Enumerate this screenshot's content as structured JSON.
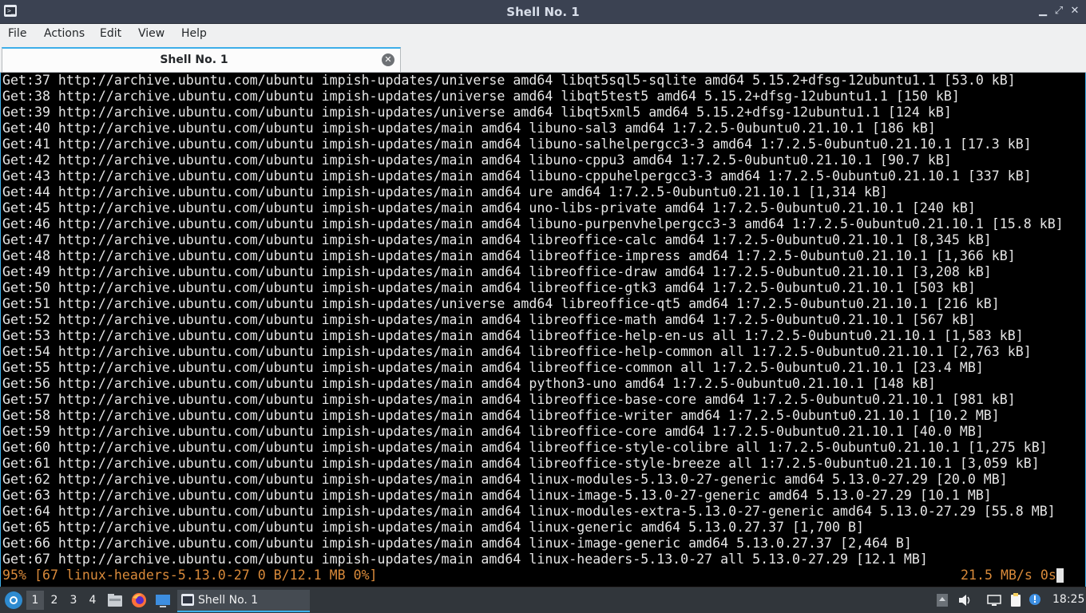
{
  "window": {
    "title": "Shell No. 1",
    "terminal_icon_glyph": ">_"
  },
  "menu": [
    "File",
    "Actions",
    "Edit",
    "View",
    "Help"
  ],
  "tab": {
    "label": "Shell No. 1"
  },
  "terminal_lines": [
    "Get:37 http://archive.ubuntu.com/ubuntu impish-updates/universe amd64 libqt5sql5-sqlite amd64 5.15.2+dfsg-12ubuntu1.1 [53.0 kB]",
    "Get:38 http://archive.ubuntu.com/ubuntu impish-updates/universe amd64 libqt5test5 amd64 5.15.2+dfsg-12ubuntu1.1 [150 kB]",
    "Get:39 http://archive.ubuntu.com/ubuntu impish-updates/universe amd64 libqt5xml5 amd64 5.15.2+dfsg-12ubuntu1.1 [124 kB]",
    "Get:40 http://archive.ubuntu.com/ubuntu impish-updates/main amd64 libuno-sal3 amd64 1:7.2.5-0ubuntu0.21.10.1 [186 kB]",
    "Get:41 http://archive.ubuntu.com/ubuntu impish-updates/main amd64 libuno-salhelpergcc3-3 amd64 1:7.2.5-0ubuntu0.21.10.1 [17.3 kB]",
    "Get:42 http://archive.ubuntu.com/ubuntu impish-updates/main amd64 libuno-cppu3 amd64 1:7.2.5-0ubuntu0.21.10.1 [90.7 kB]",
    "Get:43 http://archive.ubuntu.com/ubuntu impish-updates/main amd64 libuno-cppuhelpergcc3-3 amd64 1:7.2.5-0ubuntu0.21.10.1 [337 kB]",
    "Get:44 http://archive.ubuntu.com/ubuntu impish-updates/main amd64 ure amd64 1:7.2.5-0ubuntu0.21.10.1 [1,314 kB]",
    "Get:45 http://archive.ubuntu.com/ubuntu impish-updates/main amd64 uno-libs-private amd64 1:7.2.5-0ubuntu0.21.10.1 [240 kB]",
    "Get:46 http://archive.ubuntu.com/ubuntu impish-updates/main amd64 libuno-purpenvhelpergcc3-3 amd64 1:7.2.5-0ubuntu0.21.10.1 [15.8 kB]",
    "Get:47 http://archive.ubuntu.com/ubuntu impish-updates/main amd64 libreoffice-calc amd64 1:7.2.5-0ubuntu0.21.10.1 [8,345 kB]",
    "Get:48 http://archive.ubuntu.com/ubuntu impish-updates/main amd64 libreoffice-impress amd64 1:7.2.5-0ubuntu0.21.10.1 [1,366 kB]",
    "Get:49 http://archive.ubuntu.com/ubuntu impish-updates/main amd64 libreoffice-draw amd64 1:7.2.5-0ubuntu0.21.10.1 [3,208 kB]",
    "Get:50 http://archive.ubuntu.com/ubuntu impish-updates/main amd64 libreoffice-gtk3 amd64 1:7.2.5-0ubuntu0.21.10.1 [503 kB]",
    "Get:51 http://archive.ubuntu.com/ubuntu impish-updates/universe amd64 libreoffice-qt5 amd64 1:7.2.5-0ubuntu0.21.10.1 [216 kB]",
    "Get:52 http://archive.ubuntu.com/ubuntu impish-updates/main amd64 libreoffice-math amd64 1:7.2.5-0ubuntu0.21.10.1 [567 kB]",
    "Get:53 http://archive.ubuntu.com/ubuntu impish-updates/main amd64 libreoffice-help-en-us all 1:7.2.5-0ubuntu0.21.10.1 [1,583 kB]",
    "Get:54 http://archive.ubuntu.com/ubuntu impish-updates/main amd64 libreoffice-help-common all 1:7.2.5-0ubuntu0.21.10.1 [2,763 kB]",
    "Get:55 http://archive.ubuntu.com/ubuntu impish-updates/main amd64 libreoffice-common all 1:7.2.5-0ubuntu0.21.10.1 [23.4 MB]",
    "Get:56 http://archive.ubuntu.com/ubuntu impish-updates/main amd64 python3-uno amd64 1:7.2.5-0ubuntu0.21.10.1 [148 kB]",
    "Get:57 http://archive.ubuntu.com/ubuntu impish-updates/main amd64 libreoffice-base-core amd64 1:7.2.5-0ubuntu0.21.10.1 [981 kB]",
    "Get:58 http://archive.ubuntu.com/ubuntu impish-updates/main amd64 libreoffice-writer amd64 1:7.2.5-0ubuntu0.21.10.1 [10.2 MB]",
    "Get:59 http://archive.ubuntu.com/ubuntu impish-updates/main amd64 libreoffice-core amd64 1:7.2.5-0ubuntu0.21.10.1 [40.0 MB]",
    "Get:60 http://archive.ubuntu.com/ubuntu impish-updates/main amd64 libreoffice-style-colibre all 1:7.2.5-0ubuntu0.21.10.1 [1,275 kB]",
    "Get:61 http://archive.ubuntu.com/ubuntu impish-updates/main amd64 libreoffice-style-breeze all 1:7.2.5-0ubuntu0.21.10.1 [3,059 kB]",
    "Get:62 http://archive.ubuntu.com/ubuntu impish-updates/main amd64 linux-modules-5.13.0-27-generic amd64 5.13.0-27.29 [20.0 MB]",
    "Get:63 http://archive.ubuntu.com/ubuntu impish-updates/main amd64 linux-image-5.13.0-27-generic amd64 5.13.0-27.29 [10.1 MB]",
    "Get:64 http://archive.ubuntu.com/ubuntu impish-updates/main amd64 linux-modules-extra-5.13.0-27-generic amd64 5.13.0-27.29 [55.8 MB]",
    "Get:65 http://archive.ubuntu.com/ubuntu impish-updates/main amd64 linux-generic amd64 5.13.0.27.37 [1,700 B]",
    "Get:66 http://archive.ubuntu.com/ubuntu impish-updates/main amd64 linux-image-generic amd64 5.13.0.27.37 [2,464 B]",
    "Get:67 http://archive.ubuntu.com/ubuntu impish-updates/main amd64 linux-headers-5.13.0-27 all 5.13.0-27.29 [12.1 MB]"
  ],
  "progress_line": "95% [67 linux-headers-5.13.0-27 0 B/12.1 MB 0%]",
  "rate_line": "21.5 MB/s 0s",
  "colors": {
    "progress_text": "#d98a3a",
    "accent": "#3daee9",
    "terminal_bg": "#000000"
  },
  "taskbar": {
    "workspaces": [
      "1",
      "2",
      "3",
      "4"
    ],
    "active_workspace": "1",
    "launchers": [
      "file-manager-icon",
      "firefox-icon",
      "desktop-icon"
    ],
    "task_label": "Shell No. 1",
    "clock": "18:25"
  }
}
